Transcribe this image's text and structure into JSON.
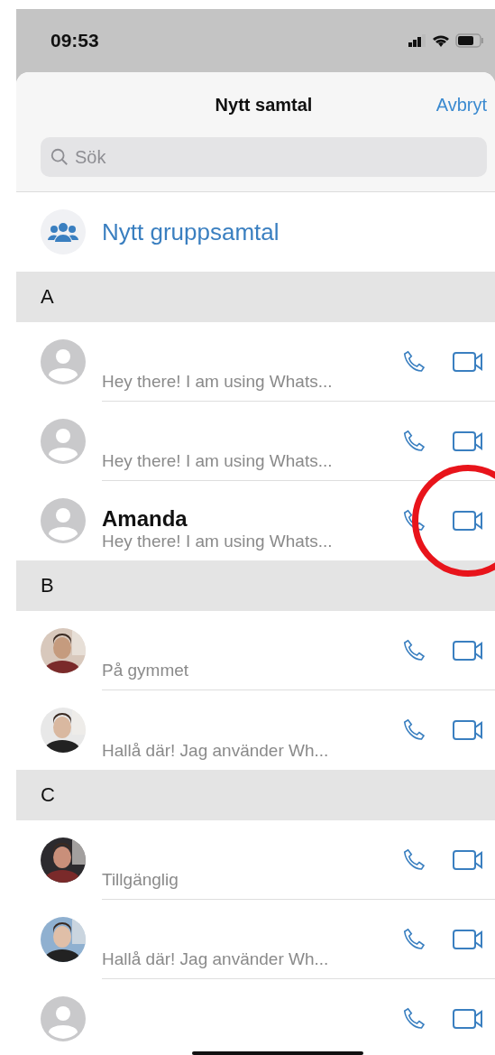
{
  "status_bar": {
    "time": "09:53"
  },
  "header": {
    "title": "Nytt samtal",
    "cancel": "Avbryt"
  },
  "search": {
    "placeholder": "Sök"
  },
  "group_call": {
    "label": "Nytt gruppsamtal"
  },
  "sections": [
    {
      "letter": "A",
      "contacts": [
        {
          "kind": "default",
          "status": "Hey there! I am using Whats...",
          "highlighted": false
        },
        {
          "kind": "default",
          "status": "Hey there! I am using Whats...",
          "highlighted": false
        },
        {
          "kind": "default",
          "name": "Amanda",
          "status": "Hey there! I am using Whats...",
          "highlighted": true
        }
      ]
    },
    {
      "letter": "B",
      "contacts": [
        {
          "status": "På gymmet",
          "highlighted": false
        },
        {
          "status": "Hallå där! Jag använder Wh...",
          "highlighted": false
        }
      ]
    },
    {
      "letter": "C",
      "contacts": [
        {
          "status": "Tillgänglig",
          "highlighted": false
        },
        {
          "status": "Hallå där! Jag använder Wh...",
          "highlighted": false
        },
        {
          "kind": "default",
          "highlighted": false
        }
      ]
    }
  ]
}
